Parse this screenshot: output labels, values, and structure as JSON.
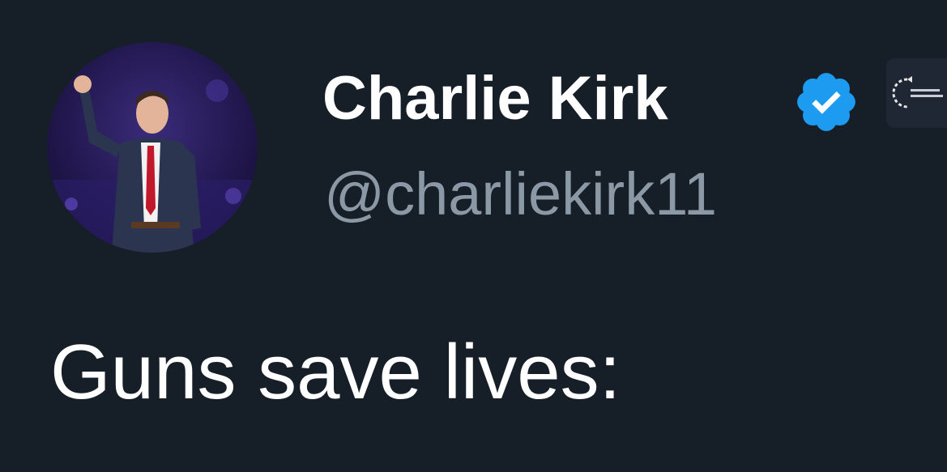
{
  "tweet": {
    "author": {
      "display_name": "Charlie Kirk",
      "handle": "@charliekirk11",
      "verified": true,
      "avatar_icon": "profile-photo",
      "affiliate_icon": "organization-logo"
    },
    "text": "Guns save lives:"
  },
  "colors": {
    "background": "#161e27",
    "name": "#ffffff",
    "handle": "#8b98a5",
    "verified_badge": "#1d9bf0",
    "text": "#ffffff"
  }
}
